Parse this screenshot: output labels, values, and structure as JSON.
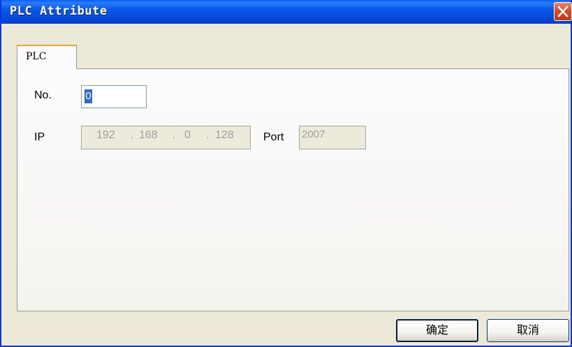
{
  "window": {
    "title": "PLC Attribute"
  },
  "tabs": [
    {
      "label": "PLC"
    }
  ],
  "form": {
    "no_label": "No.",
    "no_value": "0",
    "ip_label": "IP",
    "ip_octets": [
      "192",
      "168",
      "0",
      "128"
    ],
    "ip_separator": ".",
    "port_label": "Port",
    "port_value": "2007"
  },
  "buttons": {
    "ok_label": "确定",
    "cancel_label": "取消"
  },
  "colors": {
    "title_bar": "#0858e8",
    "close_button": "#dd4b22",
    "tab_accent": "#e8a537",
    "selection": "#316ac5",
    "dialog_face": "#ece9d8"
  },
  "icons": {
    "close": "close-icon"
  }
}
